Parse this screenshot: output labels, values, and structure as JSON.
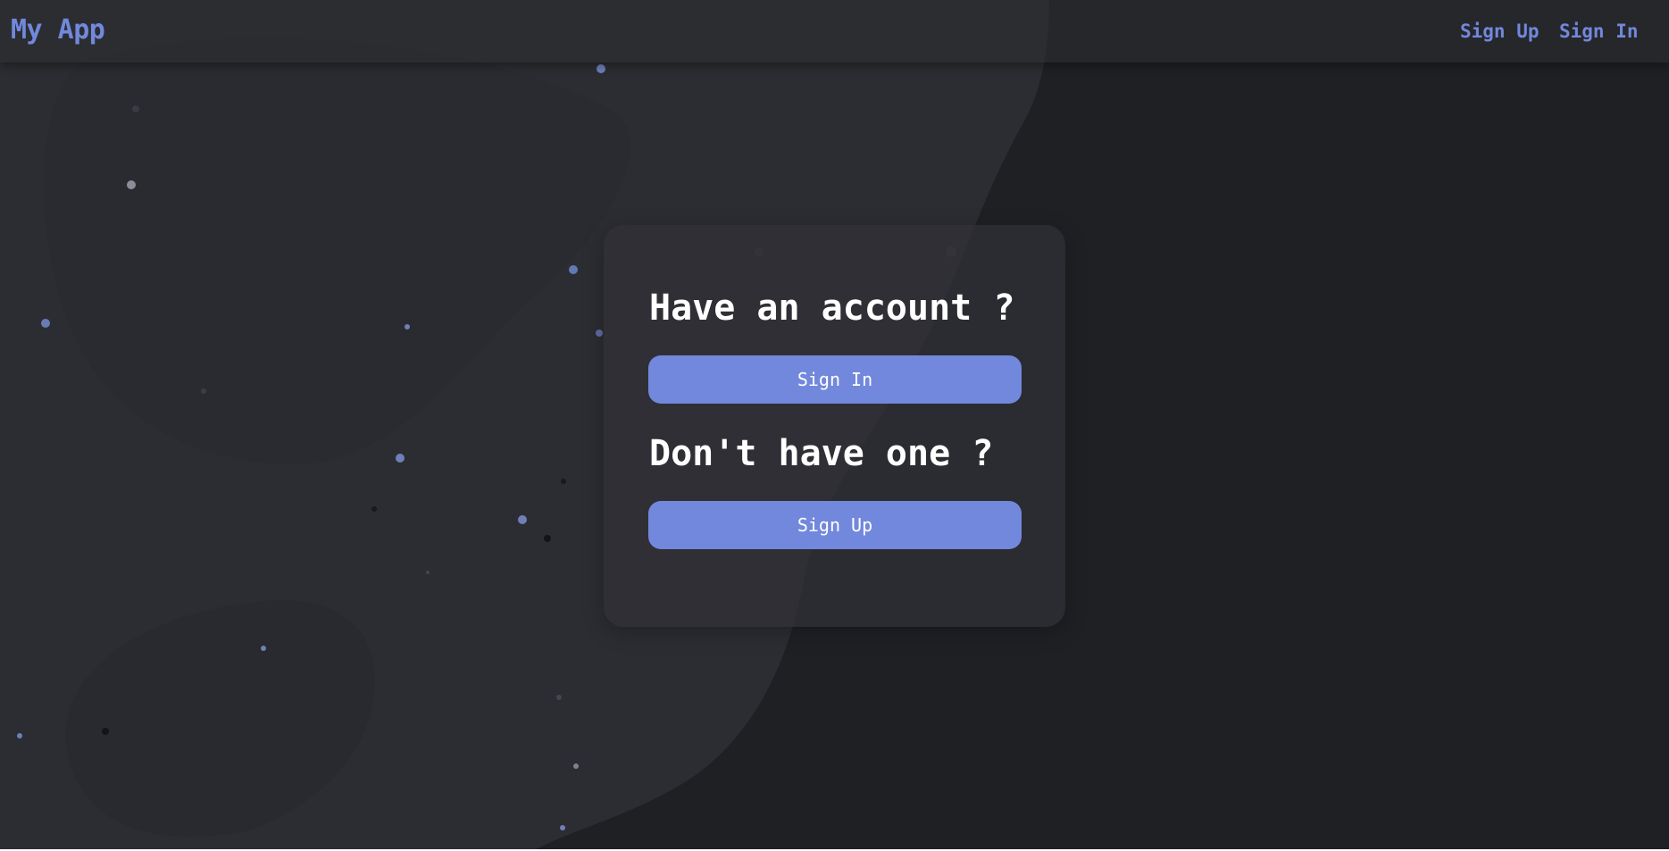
{
  "navbar": {
    "brand": "My App",
    "links": [
      "Sign Up",
      "Sign In"
    ]
  },
  "card": {
    "have_account_heading": "Have an account ?",
    "sign_in_button": "Sign In",
    "no_account_heading": "Don't have one ?",
    "sign_up_button": "Sign Up"
  },
  "colors": {
    "accent": "#7288dc",
    "background_dark": "#1f2024",
    "background_light": "#2c2d32",
    "card": "#303136",
    "text": "#ffffff"
  }
}
